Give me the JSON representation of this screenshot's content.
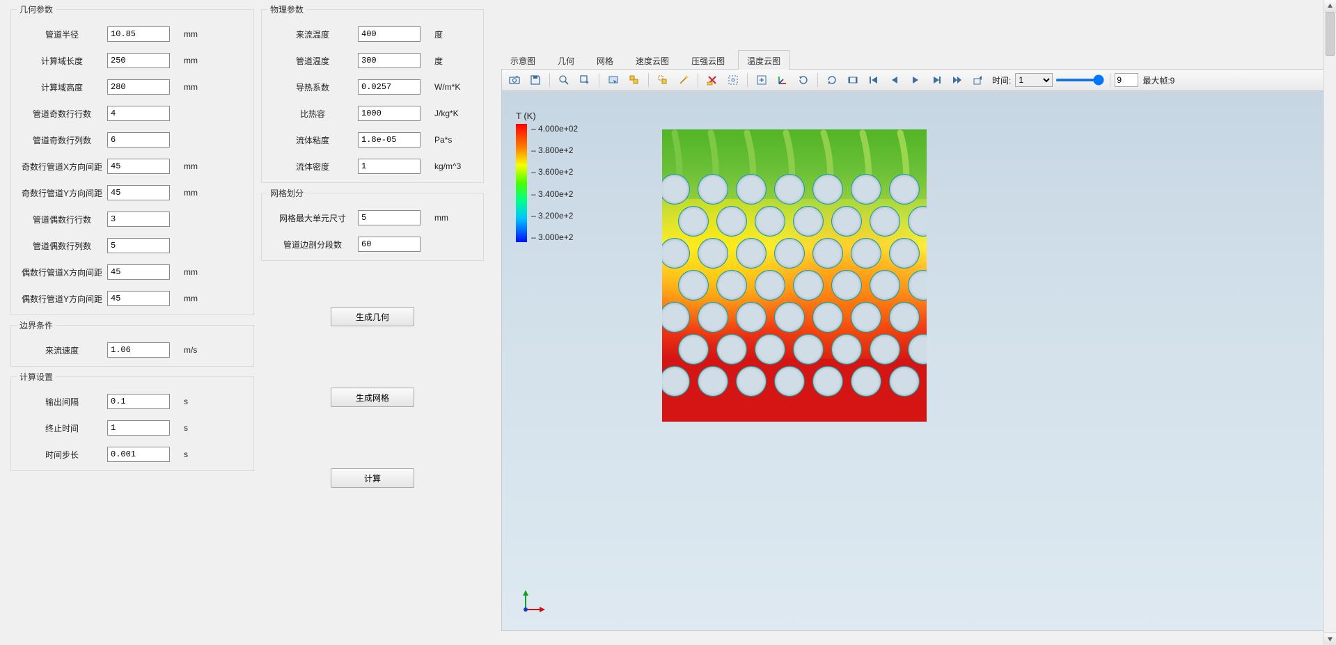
{
  "groups": {
    "geometry": {
      "legend": "几何参数",
      "rows": [
        {
          "label": "管道半径",
          "value": "10.85",
          "unit": "mm"
        },
        {
          "label": "计算域长度",
          "value": "250",
          "unit": "mm"
        },
        {
          "label": "计算域高度",
          "value": "280",
          "unit": "mm"
        },
        {
          "label": "管道奇数行行数",
          "value": "4",
          "unit": ""
        },
        {
          "label": "管道奇数行列数",
          "value": "6",
          "unit": ""
        },
        {
          "label": "奇数行管道X方向间距",
          "value": "45",
          "unit": "mm"
        },
        {
          "label": "奇数行管道Y方向间距",
          "value": "45",
          "unit": "mm"
        },
        {
          "label": "管道偶数行行数",
          "value": "3",
          "unit": ""
        },
        {
          "label": "管道偶数行列数",
          "value": "5",
          "unit": ""
        },
        {
          "label": "偶数行管道X方向间距",
          "value": "45",
          "unit": "mm"
        },
        {
          "label": "偶数行管道Y方向间距",
          "value": "45",
          "unit": "mm"
        }
      ]
    },
    "bc": {
      "legend": "边界条件",
      "rows": [
        {
          "label": "来流速度",
          "value": "1.06",
          "unit": "m/s"
        }
      ]
    },
    "solver": {
      "legend": "计算设置",
      "rows": [
        {
          "label": "输出间隔",
          "value": "0.1",
          "unit": "s"
        },
        {
          "label": "终止时间",
          "value": "1",
          "unit": "s"
        },
        {
          "label": "时间步长",
          "value": "0.001",
          "unit": "s"
        }
      ]
    },
    "physics": {
      "legend": "物理参数",
      "rows": [
        {
          "label": "来流温度",
          "value": "400",
          "unit": "度"
        },
        {
          "label": "管道温度",
          "value": "300",
          "unit": "度"
        },
        {
          "label": "导热系数",
          "value": "0.0257",
          "unit": "W/m*K"
        },
        {
          "label": "比热容",
          "value": "1000",
          "unit": "J/kg*K"
        },
        {
          "label": "流体粘度",
          "value": "1.8e-05",
          "unit": "Pa*s"
        },
        {
          "label": "流体密度",
          "value": "1",
          "unit": "kg/m^3"
        }
      ]
    },
    "mesh": {
      "legend": "网格划分",
      "rows": [
        {
          "label": "网格最大单元尺寸",
          "value": "5",
          "unit": "mm"
        },
        {
          "label": "管道边剖分段数",
          "value": "60",
          "unit": ""
        }
      ]
    }
  },
  "buttons": {
    "gen_geom": "生成几何",
    "gen_mesh": "生成网格",
    "compute": "计算"
  },
  "tabs": [
    "示意图",
    "几何",
    "网格",
    "速度云图",
    "压强云图",
    "温度云图"
  ],
  "active_tab_index": 5,
  "toolbar": {
    "icons": [
      "camera-icon",
      "save-icon",
      "zoom-icon",
      "pick-box-icon",
      "pick-surface-icon",
      "visibility-icon",
      "visibility-toggle-icon",
      "wand-icon",
      "delete-selection-icon",
      "rubber-zoom-icon",
      "fit-all-icon",
      "axis-icon",
      "rotate-icon",
      "pan-icon",
      "animation-icon",
      "rewind-icon",
      "frame-back-icon",
      "play-icon",
      "frame-fwd-icon",
      "fast-fwd-icon",
      "export-anim-icon"
    ],
    "time_label": "时间:",
    "time_value": "1",
    "slider_value": 100,
    "frame_value": "9",
    "max_frame_label": "最大帧:9"
  },
  "legend": {
    "title": "T (K)",
    "ticks": [
      "4.000e+02",
      "3.800e+2",
      "3.600e+2",
      "3.400e+2",
      "3.200e+2",
      "3.000e+2"
    ]
  }
}
